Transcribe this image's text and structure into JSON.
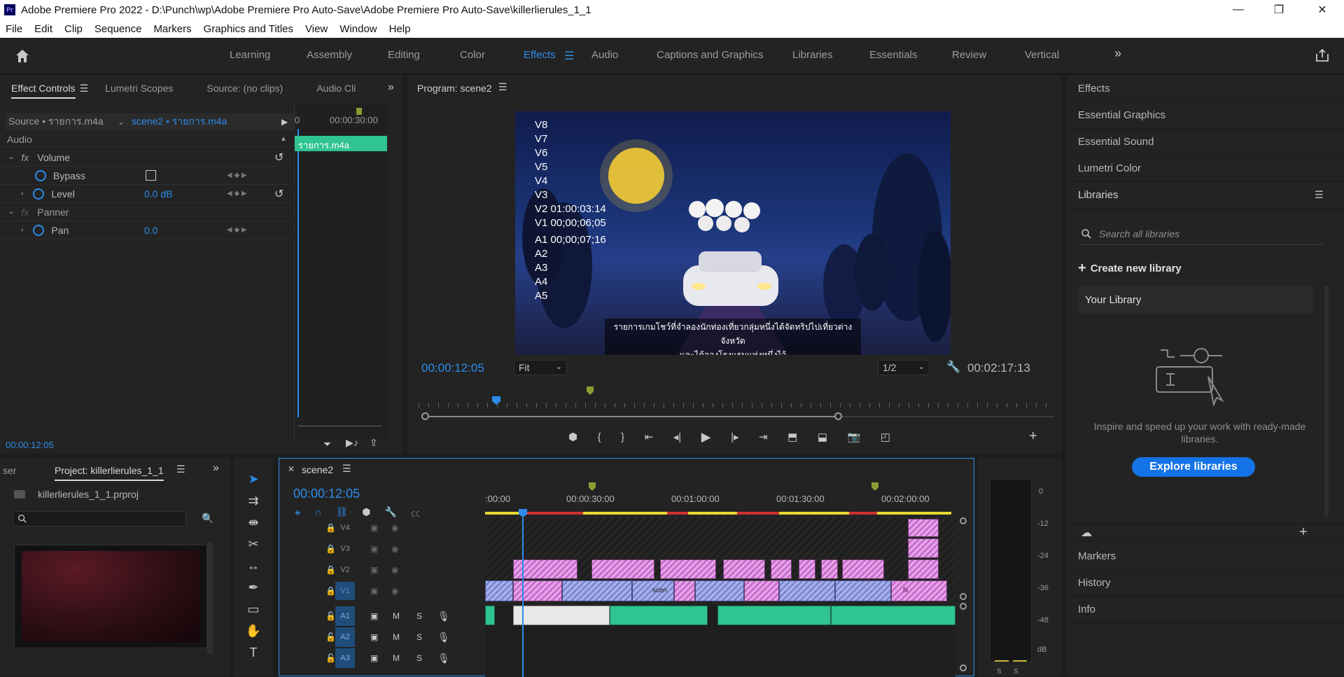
{
  "window": {
    "logo_text": "Pr",
    "title": "Adobe Premiere Pro 2022 - D:\\Punch\\wp\\Adobe Premiere Pro Auto-Save\\Adobe Premiere Pro Auto-Save\\killerlierules_1_1",
    "minimize": "—",
    "maximize": "❐",
    "close": "✕"
  },
  "menu": [
    "File",
    "Edit",
    "Clip",
    "Sequence",
    "Markers",
    "Graphics and Titles",
    "View",
    "Window",
    "Help"
  ],
  "workspaces": {
    "items": [
      "Learning",
      "Assembly",
      "Editing",
      "Color",
      "Effects",
      "Audio",
      "Captions and Graphics",
      "Libraries",
      "Essentials",
      "Review",
      "Vertical"
    ],
    "active": "Effects",
    "more": "»"
  },
  "effect_controls": {
    "tabs": [
      "Effect Controls",
      "Lumetri Scopes",
      "Source: (no clips)",
      "Audio Clip"
    ],
    "source_label": "Source • รายการ.m4a",
    "sequence_label": "scene2 • รายการ.m4a",
    "ruler_start": "0",
    "ruler_time": "00:00:30:00",
    "clip_name": "รายการ.m4a",
    "section": "Audio",
    "volume_label": "Volume",
    "bypass_label": "Bypass",
    "level_label": "Level",
    "level_value": "0.0 dB",
    "panner_label": "Panner",
    "pan_label": "Pan",
    "pan_value": "0.0",
    "fx": "fx",
    "timecode": "00:00:12:05"
  },
  "program": {
    "title": "Program: scene2",
    "timecode": "00:00:12:05",
    "duration": "00:02:17:13",
    "fit": "Fit",
    "resolution": "1/2",
    "overlay_lines": [
      "V8",
      "V7",
      "V6",
      "V5",
      "V4",
      "V3",
      "V2 01:00:03:14",
      "V1 00;00;06;05",
      "A1 00;00;07;16",
      "A2",
      "A3",
      "A4",
      "A5"
    ],
    "subtitle_line1": "รายการเกมโชว์ที่จำลองนักท่องเที่ยวกลุ่มหนึ่งได้จัดทริปไปเที่ยวต่างจังหวัด",
    "subtitle_line2": "และได้จองโรงแรมแห่งหนึ่งไว้"
  },
  "right_panel": {
    "items": [
      "Effects",
      "Essential Graphics",
      "Essential Sound",
      "Lumetri Color"
    ],
    "libraries_title": "Libraries",
    "search_placeholder": "Search all libraries",
    "create_library": "Create new library",
    "your_library": "Your Library",
    "inspire_text": "Inspire and speed up your work with ready-made libraries.",
    "explore_button": "Explore libraries",
    "bottom_items": [
      "Markers",
      "History",
      "Info"
    ]
  },
  "project": {
    "tab_partial": "ser",
    "tab": "Project: killerlierules_1_1",
    "file": "killerlierules_1_1.prproj"
  },
  "timeline": {
    "tab": "scene2",
    "timecode": "00:00:12:05",
    "ruler": [
      ":00:00",
      "00:00:30:00",
      "00:01:00:00",
      "00:01:30:00",
      "00:02:00:00"
    ],
    "video_tracks": [
      "V4",
      "V3",
      "V2",
      "V1"
    ],
    "audio_tracks": [
      "A1",
      "A2",
      "A3"
    ],
    "mute": "M",
    "solo": "S",
    "clip_label_scen": "scen",
    "clip_label_fx": "fx"
  },
  "meter": {
    "labels": [
      "0",
      "-12",
      "-24",
      "-36",
      "-48",
      "dB"
    ],
    "bottom": [
      "S",
      "S"
    ]
  },
  "colors": {
    "accent": "#2d8ceb",
    "panel": "#232323",
    "bg": "#1d1d1d",
    "audio_clip": "#2fc490",
    "video_clip_pink": "#d88bdc",
    "video_clip_blue": "#8e98de"
  }
}
